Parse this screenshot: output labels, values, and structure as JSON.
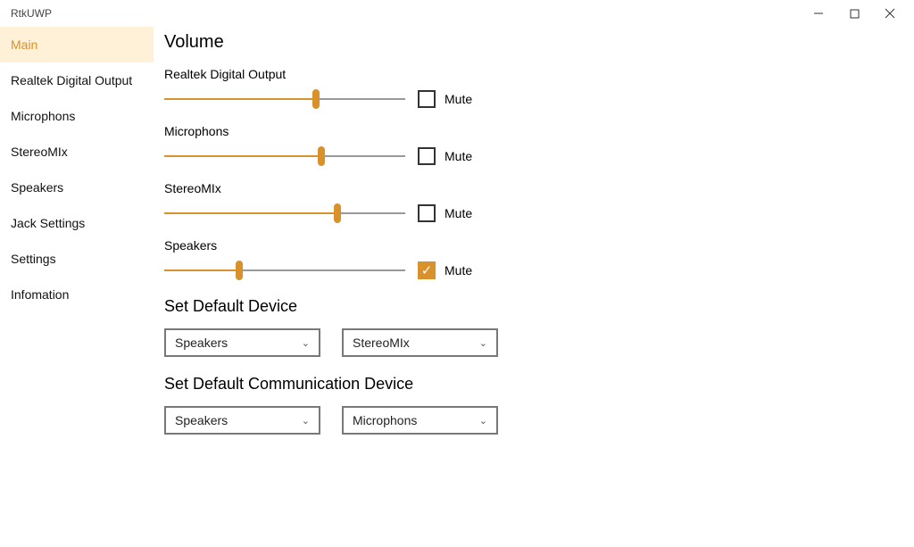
{
  "app_title": "RtkUWP",
  "accent": "#d9912b",
  "sidebar": {
    "items": [
      {
        "label": "Main",
        "active": true
      },
      {
        "label": "Realtek Digital Output",
        "active": false
      },
      {
        "label": "Microphons",
        "active": false
      },
      {
        "label": "StereoMIx",
        "active": false
      },
      {
        "label": "Speakers",
        "active": false
      },
      {
        "label": "Jack Settings",
        "active": false
      },
      {
        "label": "Settings",
        "active": false
      },
      {
        "label": "Infomation",
        "active": false
      }
    ]
  },
  "main": {
    "volume_heading": "Volume",
    "mute_label": "Mute",
    "devices": [
      {
        "name": "Realtek Digital Output",
        "level": 63,
        "muted": false
      },
      {
        "name": "Microphons",
        "level": 65,
        "muted": false
      },
      {
        "name": "StereoMIx",
        "level": 72,
        "muted": false
      },
      {
        "name": "Speakers",
        "level": 31,
        "muted": true
      }
    ],
    "set_default_heading": "Set Default Device",
    "default_device_playback": "Speakers",
    "default_device_capture": "StereoMIx",
    "set_default_comm_heading": "Set Default Communication Device",
    "default_comm_playback": "Speakers",
    "default_comm_capture": "Microphons"
  }
}
